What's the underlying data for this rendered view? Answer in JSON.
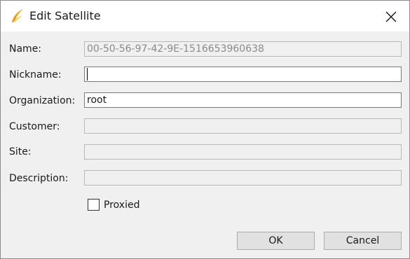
{
  "window": {
    "title": "Edit Satellite",
    "app_icon": "wing-icon",
    "close_icon": "close-icon"
  },
  "form": {
    "name": {
      "label": "Name:",
      "value": "00-50-56-97-42-9E-1516653960638"
    },
    "nickname": {
      "label": "Nickname:",
      "value": ""
    },
    "organization": {
      "label": "Organization:",
      "value": "root"
    },
    "customer": {
      "label": "Customer:",
      "value": ""
    },
    "site": {
      "label": "Site:",
      "value": ""
    },
    "description": {
      "label": "Description:",
      "value": ""
    },
    "proxied": {
      "label": "Proxied",
      "checked": false
    }
  },
  "buttons": {
    "ok": "OK",
    "cancel": "Cancel"
  },
  "colors": {
    "accent_icon": "#f2b22a",
    "dialog_bg": "#f0f0f0"
  }
}
